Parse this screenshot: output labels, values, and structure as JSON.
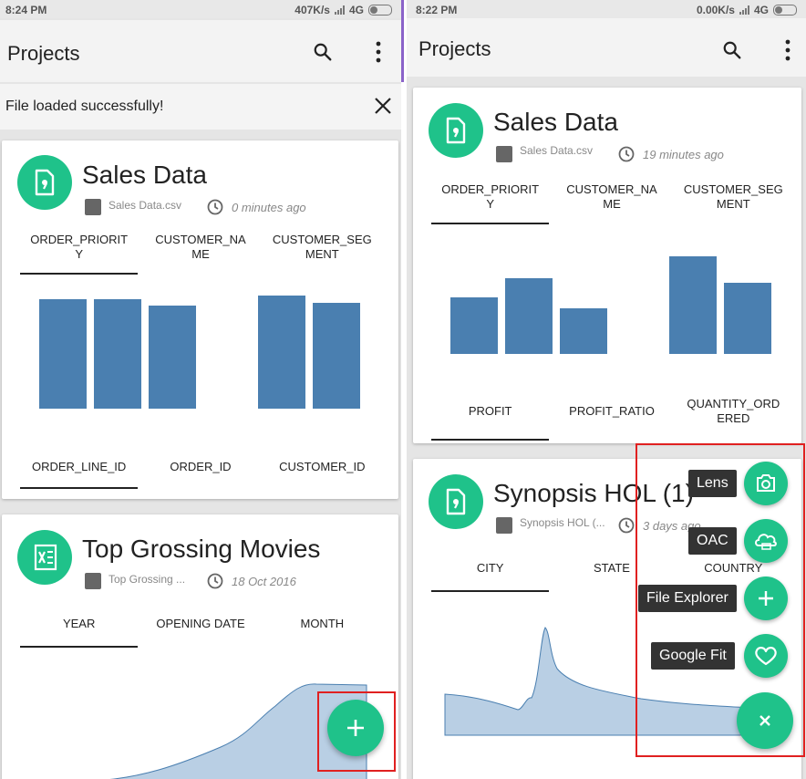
{
  "left": {
    "status": {
      "time": "8:24 PM",
      "speed": "407K/s",
      "network": "4G"
    },
    "app_title": "Projects",
    "snackbar": "File loaded successfully!",
    "card1": {
      "title": "Sales Data",
      "file": "Sales Data.csv",
      "time": "0 minutes ago",
      "tabs_top": [
        "ORDER_PRIORITY",
        "CUSTOMER_NAME",
        "CUSTOMER_SEGMENT"
      ],
      "tabs_bottom": [
        "ORDER_LINE_ID",
        "ORDER_ID",
        "CUSTOMER_ID"
      ],
      "chart_values": [
        100,
        100,
        94,
        0,
        103,
        96
      ]
    },
    "card2": {
      "title": "Top Grossing Movies",
      "file": "Top Grossing ...",
      "time": "18 Oct 2016",
      "tabs": [
        "YEAR",
        "OPENING DATE",
        "MONTH"
      ]
    },
    "fab_label": "+"
  },
  "right": {
    "status": {
      "time": "8:22 PM",
      "speed": "0.00K/s",
      "network": "4G"
    },
    "app_title": "Projects",
    "card1": {
      "title": "Sales Data",
      "file": "Sales Data.csv",
      "time": "19 minutes ago",
      "tabs_top": [
        "ORDER_PRIORITY",
        "CUSTOMER_NAME",
        "CUSTOMER_SEGMENT"
      ],
      "tabs_bottom": [
        "PROFIT",
        "PROFIT_RATIO",
        "QUANTITY_ORDERED"
      ],
      "chart_values": [
        60,
        80,
        48,
        0,
        103,
        75
      ]
    },
    "card2": {
      "title": "Synopsis HOL (1)",
      "file": "Synopsis HOL (...",
      "time": "3 days ago",
      "tabs": [
        "CITY",
        "STATE",
        "COUNTRY"
      ]
    },
    "speed_dial": {
      "items": [
        {
          "label": "Lens",
          "icon": "camera-icon"
        },
        {
          "label": "OAC",
          "icon": "cloud-icon"
        },
        {
          "label": "File Explorer",
          "icon": "plus-icon"
        },
        {
          "label": "Google Fit",
          "icon": "heart-icon"
        }
      ],
      "close_label": "×"
    }
  },
  "colors": {
    "accent": "#1fc28a",
    "bar": "#4a7fb0",
    "area": "#b9cfe4",
    "highlight": "#e02020"
  }
}
